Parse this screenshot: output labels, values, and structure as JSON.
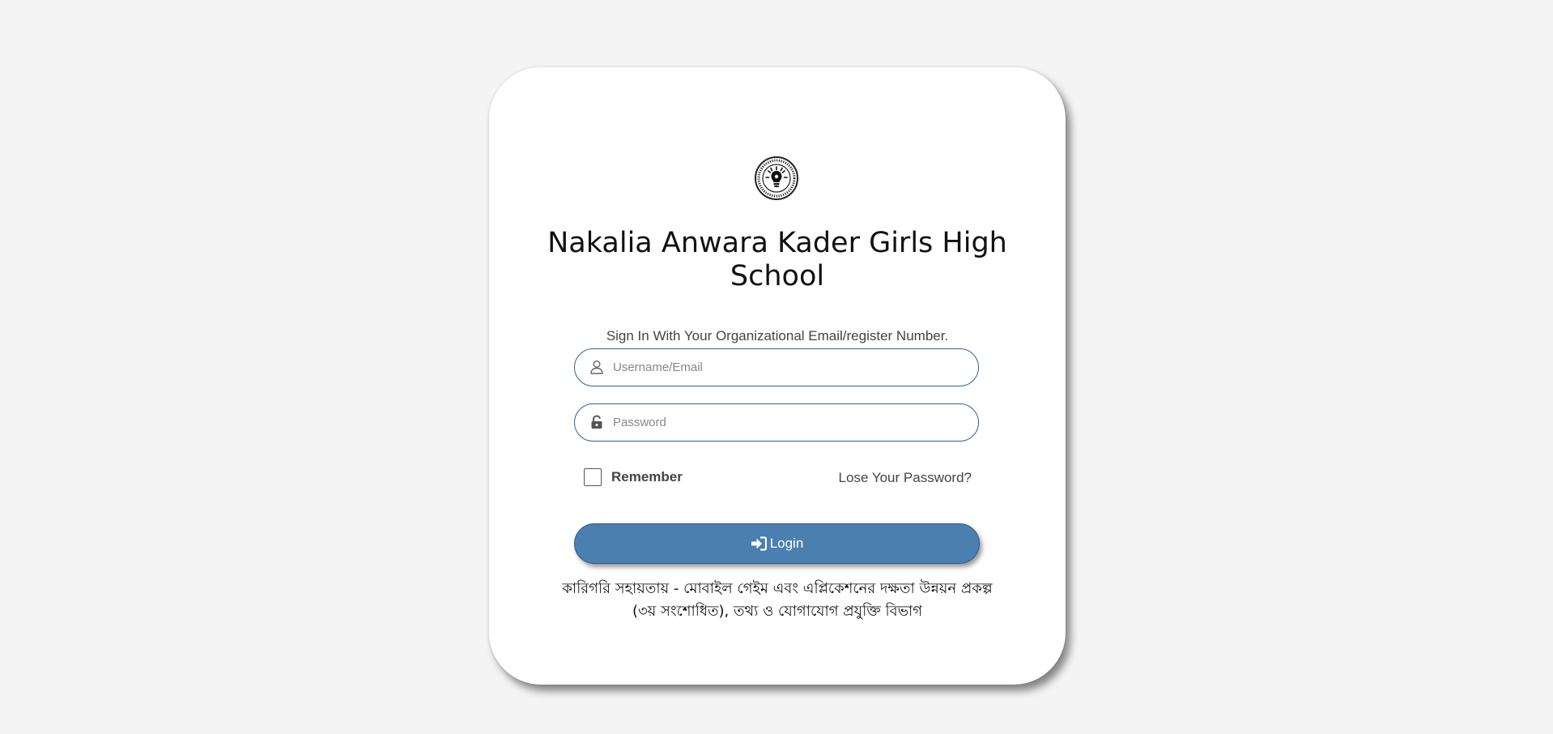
{
  "school": {
    "name": "Nakalia Anwara Kader Girls High School",
    "logo_icon": "school-seal-lightbulb-icon"
  },
  "login": {
    "subtitle": "Sign In With Your Organizational Email/register Number.",
    "username_placeholder": "Username/Email",
    "username_icon": "user-icon",
    "password_placeholder": "Password",
    "password_icon": "lock-icon",
    "remember_label": "Remember",
    "lost_password_label": "Lose Your Password?",
    "login_button_label": "Login",
    "login_button_icon": "sign-in-icon"
  },
  "footer": {
    "credit": "কারিগরি সহায়তায় - মোবাইল গেইম এবং এপ্লিকেশনের দক্ষতা উন্নয়ন প্রকল্প (৩য় সংশোধিত), তথ্য ও যোগাযোগ প্রযুক্তি বিভাগ"
  },
  "colors": {
    "accent": "#4a7fb0",
    "field_border": "#2f6099",
    "page_background": "#f4f4f4"
  }
}
